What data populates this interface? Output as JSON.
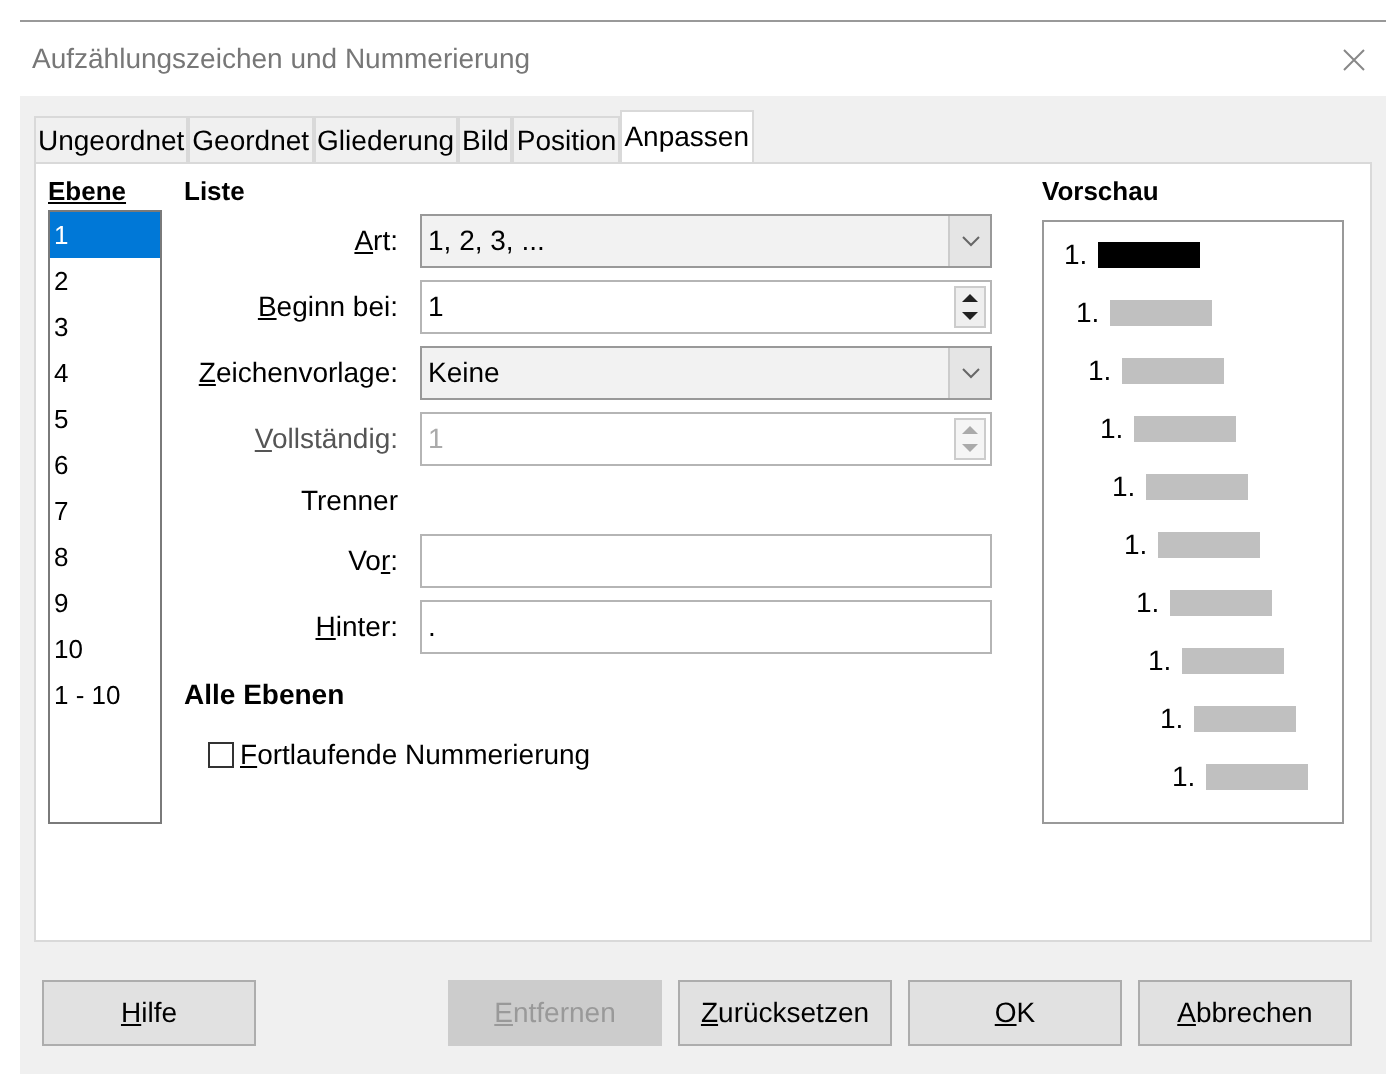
{
  "window": {
    "title": "Aufzählungszeichen und Nummerierung"
  },
  "tabs": [
    {
      "label": "Ungeordnet",
      "selected": false
    },
    {
      "label": "Geordnet",
      "selected": false
    },
    {
      "label": "Gliederung",
      "selected": false
    },
    {
      "label": "Bild",
      "selected": false
    },
    {
      "label": "Position",
      "selected": false
    },
    {
      "label": "Anpassen",
      "selected": true
    }
  ],
  "levels": {
    "heading": "Ebene",
    "items": [
      {
        "label": "1",
        "selected": true
      },
      {
        "label": "2",
        "selected": false
      },
      {
        "label": "3",
        "selected": false
      },
      {
        "label": "4",
        "selected": false
      },
      {
        "label": "5",
        "selected": false
      },
      {
        "label": "6",
        "selected": false
      },
      {
        "label": "7",
        "selected": false
      },
      {
        "label": "8",
        "selected": false
      },
      {
        "label": "9",
        "selected": false
      },
      {
        "label": "10",
        "selected": false
      },
      {
        "label": "1 - 10",
        "selected": false
      }
    ]
  },
  "list": {
    "heading": "Liste",
    "fields": [
      {
        "kind": "dropdown",
        "label": {
          "key": "A",
          "post": "rt:"
        },
        "value": "1, 2, 3, ..."
      },
      {
        "kind": "spin",
        "label": {
          "key": "B",
          "post": "eginn bei:"
        },
        "value": "1",
        "disabled": false
      },
      {
        "kind": "dropdown",
        "label": {
          "key": "Z",
          "post": "eichenvorlage:"
        },
        "value": "Keine"
      },
      {
        "kind": "spin",
        "label": {
          "key": "V",
          "post": "ollständig:"
        },
        "value": "1",
        "disabled": true
      },
      {
        "kind": "heading",
        "label": {
          "pre": "Trenner"
        }
      },
      {
        "kind": "text",
        "label": {
          "pre": "Vo",
          "key": "r",
          "post": ":"
        }
      },
      {
        "kind": "text",
        "label": {
          "key": "H",
          "post": "inter:"
        },
        "value": "."
      }
    ]
  },
  "all_levels": {
    "heading": "Alle Ebenen",
    "checkbox": {
      "label": {
        "key": "F",
        "post": "ortlaufende Nummerierung"
      },
      "checked": false
    }
  },
  "preview": {
    "heading": "Vorschau",
    "items": [
      {
        "number": "1.",
        "selected": true
      },
      {
        "number": "1.",
        "selected": false
      },
      {
        "number": "1.",
        "selected": false
      },
      {
        "number": "1.",
        "selected": false
      },
      {
        "number": "1.",
        "selected": false
      },
      {
        "number": "1.",
        "selected": false
      },
      {
        "number": "1.",
        "selected": false
      },
      {
        "number": "1.",
        "selected": false
      },
      {
        "number": "1.",
        "selected": false
      },
      {
        "number": "1.",
        "selected": false
      }
    ]
  },
  "buttons": [
    {
      "label": {
        "key": "H",
        "post": "ilfe"
      },
      "disabled": false
    },
    {
      "label": {
        "key": "E",
        "post": "ntfernen"
      },
      "disabled": true
    },
    {
      "label": {
        "key": "Z",
        "post": "urücksetzen"
      },
      "disabled": false
    },
    {
      "label": {
        "key": "O",
        "post": "K"
      },
      "disabled": false
    },
    {
      "label": {
        "key": "A",
        "post": "bbrechen"
      },
      "disabled": false
    }
  ]
}
